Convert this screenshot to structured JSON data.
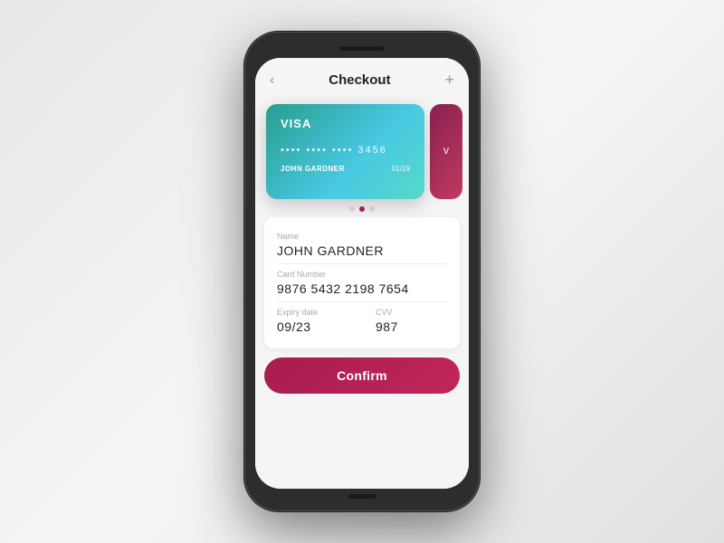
{
  "header": {
    "title": "Checkout",
    "back_icon": "‹",
    "add_icon": "+"
  },
  "card": {
    "brand": "VISA",
    "number_masked": "•••• •••• •••• 3456",
    "name": "JOHN GARDNER",
    "expiry": "01/19",
    "gradient_start": "#2a9d8f",
    "gradient_end": "#48cae4"
  },
  "card_peek": {
    "letter": "V",
    "gradient_start": "#8b2252",
    "gradient_end": "#c0395e"
  },
  "dots": {
    "total": 3,
    "active_index": 1
  },
  "form": {
    "name_label": "Name",
    "name_value": "JOHN GARDNER",
    "card_number_label": "Card Number",
    "card_number_value": "9876  5432  2198  7654",
    "expiry_label": "Expiry date",
    "expiry_value": "09/23",
    "cvv_label": "CVV",
    "cvv_value": "987"
  },
  "confirm_button": {
    "label": "Confirm"
  }
}
